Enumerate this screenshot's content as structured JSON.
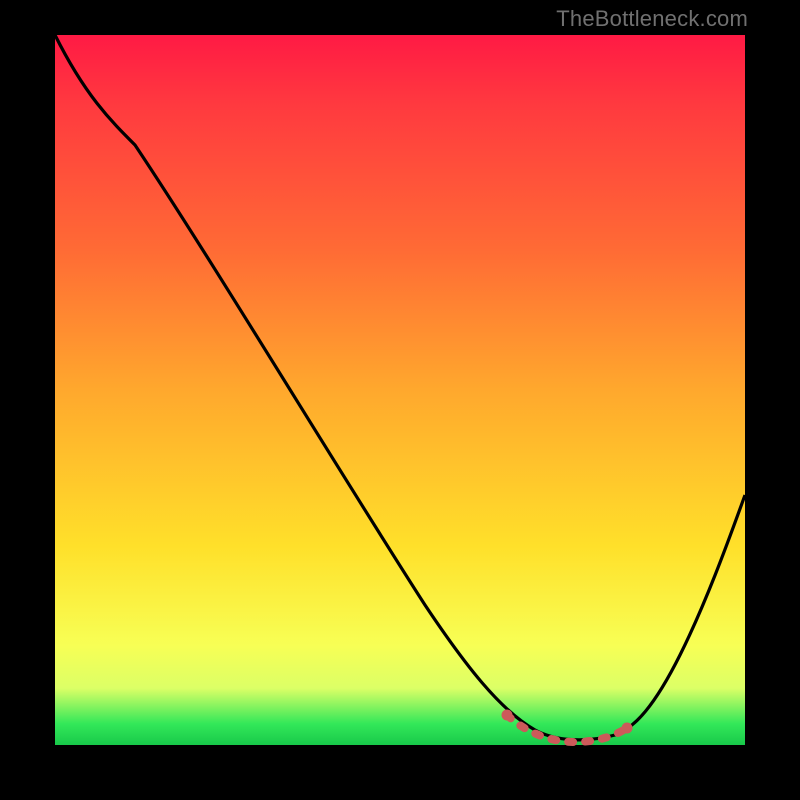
{
  "watermark": "TheBottleneck.com",
  "colors": {
    "bg": "#000000",
    "curve": "#000000",
    "marker": "#cc5a5a",
    "gradient_top": "#ff1a44",
    "gradient_mid1": "#ff6a35",
    "gradient_mid2": "#ffe02a",
    "gradient_bottom": "#18c94a"
  },
  "chart_data": {
    "type": "line",
    "title": "",
    "xlabel": "",
    "ylabel": "",
    "xlim": [
      0,
      100
    ],
    "ylim": [
      0,
      100
    ],
    "x": [
      0,
      5,
      10,
      15,
      20,
      25,
      30,
      35,
      40,
      45,
      50,
      55,
      60,
      65,
      70,
      75,
      80,
      82,
      85,
      90,
      95,
      100
    ],
    "values": [
      100,
      95,
      90,
      83,
      75,
      67,
      58,
      50,
      42,
      34,
      26,
      19,
      13,
      7,
      3,
      1,
      1,
      2,
      7,
      16,
      25,
      35
    ],
    "highlight_region": {
      "x_start": 65,
      "x_end": 82
    }
  }
}
